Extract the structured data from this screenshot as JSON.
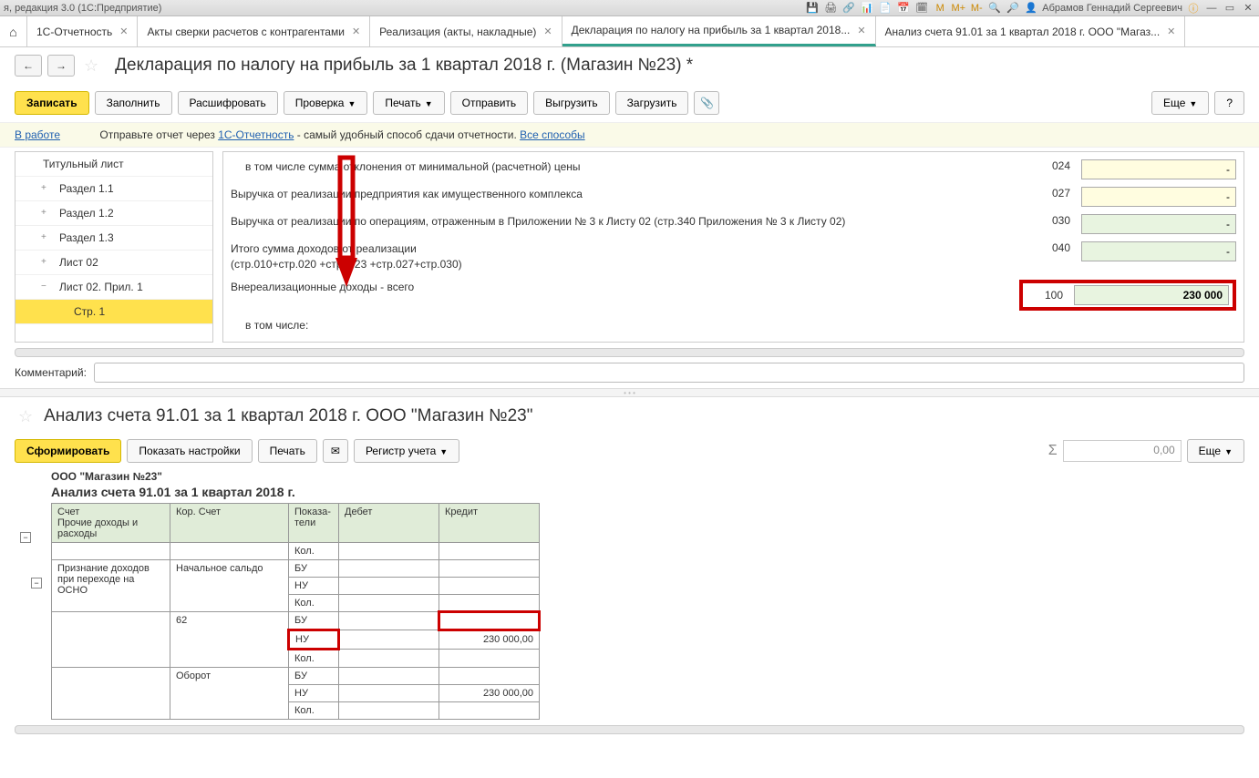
{
  "titlebar": {
    "left": "я, редакция 3.0  (1С:Предприятие)",
    "user": "Абрамов Геннадий Сергеевич",
    "m": "M",
    "mplus": "M+",
    "mminus": "M-"
  },
  "tabs": [
    {
      "label": "1С-Отчетность"
    },
    {
      "label": "Акты сверки расчетов с контрагентами"
    },
    {
      "label": "Реализация (акты, накладные)"
    },
    {
      "label": "Декларация по налогу на прибыль за 1 квартал 2018..."
    },
    {
      "label": "Анализ счета 91.01 за 1 квартал 2018 г. ООО \"Магаз..."
    }
  ],
  "page_title": "Декларация по налогу на прибыль за 1 квартал 2018 г. (Магазин №23) *",
  "toolbar": {
    "save": "Записать",
    "fill": "Заполнить",
    "decrypt": "Расшифровать",
    "check": "Проверка",
    "print": "Печать",
    "send": "Отправить",
    "export": "Выгрузить",
    "import": "Загрузить",
    "more": "Еще",
    "help": "?"
  },
  "infobar": {
    "status": "В работе",
    "text1": "Отправьте отчет через ",
    "link1": "1С-Отчетность",
    "text2": " - самый удобный способ сдачи отчетности. ",
    "link2": "Все способы"
  },
  "tree": [
    {
      "label": "Титульный лист",
      "level": 0
    },
    {
      "label": "Раздел 1.1",
      "level": 1,
      "exp": "+"
    },
    {
      "label": "Раздел 1.2",
      "level": 1,
      "exp": "+"
    },
    {
      "label": "Раздел 1.3",
      "level": 1,
      "exp": "+"
    },
    {
      "label": "Лист 02",
      "level": 1,
      "exp": "+"
    },
    {
      "label": "Лист 02. Прил. 1",
      "level": 1,
      "exp": "−"
    },
    {
      "label": "Стр. 1",
      "level": 2,
      "selected": true
    }
  ],
  "rows": [
    {
      "label": "в том числе сумма отклонения от минимальной (расчетной) цены",
      "indent": true,
      "code": "024",
      "value": "-",
      "cls": "yellow"
    },
    {
      "label": "Выручка от реализации предприятия как имущественного комплекса",
      "code": "027",
      "value": "-",
      "cls": "yellow"
    },
    {
      "label": "Выручка от реализации по операциям, отраженным в Приложении № 3 к Листу 02 (стр.340 Приложения № 3 к Листу 02)",
      "code": "030",
      "value": "-",
      "cls": "green"
    },
    {
      "label": "Итого сумма доходов от реализации\n(стр.010+стр.020 +стр. 023 +стр.027+стр.030)",
      "code": "040",
      "value": "-",
      "cls": "green"
    },
    {
      "label": "Внереализационные доходы - всего",
      "code": "100",
      "value": "230 000",
      "cls": "green bold",
      "highlighted": true
    },
    {
      "label": "в том числе:",
      "indent": true
    }
  ],
  "comment_label": "Комментарий:",
  "section2": {
    "title": "Анализ счета 91.01 за 1 квартал 2018 г. ООО \"Магазин №23\"",
    "form": "Сформировать",
    "settings": "Показать настройки",
    "print": "Печать",
    "register": "Регистр учета",
    "more": "Еще",
    "sum_value": "0,00"
  },
  "report": {
    "org": "ООО \"Магазин №23\"",
    "title": "Анализ счета 91.01 за 1 квартал 2018 г.",
    "headers": {
      "c1": "Счет",
      "c1b": "Прочие доходы и расходы",
      "c2": "Кор. Счет",
      "c3": "Показа-\nтели",
      "c4": "Дебет",
      "c5": "Кредит"
    },
    "rows": [
      {
        "c1": "",
        "c2": "",
        "c3": "Кол.",
        "c4": "",
        "c5": ""
      },
      {
        "c1": "Признание доходов при переходе на ОСНО",
        "c2": "Начальное сальдо",
        "c3": "БУ",
        "c4": "",
        "c5": ""
      },
      {
        "c1": "",
        "c2": "",
        "c3": "НУ",
        "c4": "",
        "c5": ""
      },
      {
        "c1": "",
        "c2": "",
        "c3": "Кол.",
        "c4": "",
        "c5": ""
      },
      {
        "c1": "",
        "c2": "62",
        "c3": "БУ",
        "c4": "",
        "c5": "",
        "c5red": true
      },
      {
        "c1": "",
        "c2": "",
        "c3": "НУ",
        "c3red": true,
        "c4": "",
        "c5": "230 000,00"
      },
      {
        "c1": "",
        "c2": "",
        "c3": "Кол.",
        "c4": "",
        "c5": ""
      },
      {
        "c1": "",
        "c2": "Оборот",
        "c3": "БУ",
        "c4": "",
        "c5": ""
      },
      {
        "c1": "",
        "c2": "",
        "c3": "НУ",
        "c4": "",
        "c5": "230 000,00"
      },
      {
        "c1": "",
        "c2": "",
        "c3": "Кол.",
        "c4": "",
        "c5": ""
      }
    ]
  }
}
